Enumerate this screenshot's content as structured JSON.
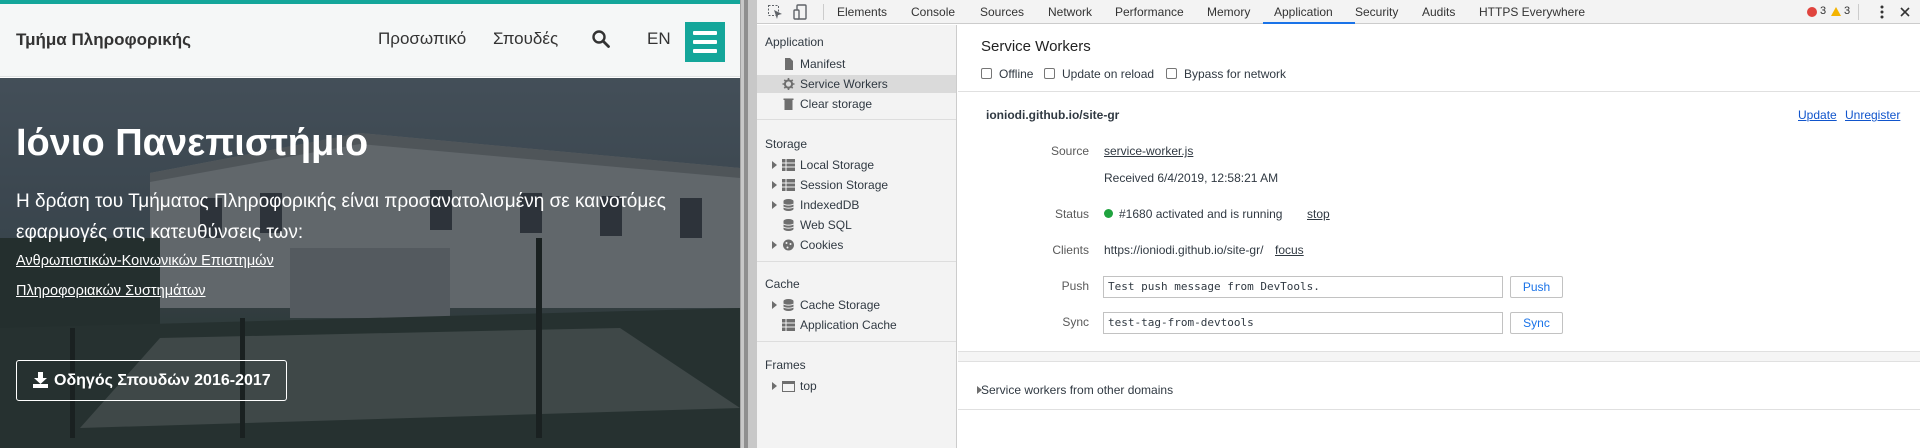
{
  "site": {
    "brand": "Τμήμα Πληροφορικής",
    "nav": [
      "Προσωπικό",
      "Σπουδές",
      "EN"
    ],
    "hero": {
      "title": "Ιόνιο Πανεπιστήμιο",
      "description": "Η δράση του Τμήματος Πληροφορικής είναι προσανατολισμένη σε καινοτόμες εφαρμογές στις κατευθύνσεις των:",
      "links": [
        "Ανθρωπιστικών-Κοινωνικών Επιστημών",
        "Πληροφοριακών Συστημάτων"
      ],
      "button": "Οδηγός Σπουδών 2016-2017"
    },
    "colors": {
      "accent": "#14a69a"
    }
  },
  "devtools": {
    "tabs": [
      "Elements",
      "Console",
      "Sources",
      "Network",
      "Performance",
      "Memory",
      "Application",
      "Security",
      "Audits",
      "HTTPS Everywhere"
    ],
    "active_tab": "Application",
    "errors": "3",
    "warnings": "3",
    "sidebar": {
      "application": {
        "title": "Application",
        "items": [
          "Manifest",
          "Service Workers",
          "Clear storage"
        ]
      },
      "storage": {
        "title": "Storage",
        "items": [
          "Local Storage",
          "Session Storage",
          "IndexedDB",
          "Web SQL",
          "Cookies"
        ]
      },
      "cache": {
        "title": "Cache",
        "items": [
          "Cache Storage",
          "Application Cache"
        ]
      },
      "frames": {
        "title": "Frames",
        "items": [
          "top"
        ]
      }
    },
    "service_workers": {
      "title": "Service Workers",
      "options": [
        "Offline",
        "Update on reload",
        "Bypass for network"
      ],
      "origin": "ioniodi.github.io/site-gr",
      "update_label": "Update",
      "unregister_label": "Unregister",
      "source_label": "Source",
      "source_file": "service-worker.js",
      "received": "Received 6/4/2019, 12:58:21 AM",
      "status_label": "Status",
      "status_text": "#1680 activated and is running",
      "stop_label": "stop",
      "clients_label": "Clients",
      "clients_url": "https://ioniodi.github.io/site-gr/",
      "focus_label": "focus",
      "push_label": "Push",
      "push_value": "Test push message from DevTools.",
      "push_button": "Push",
      "sync_label": "Sync",
      "sync_value": "test-tag-from-devtools",
      "sync_button": "Sync",
      "other_domains": "Service workers from other domains"
    }
  }
}
